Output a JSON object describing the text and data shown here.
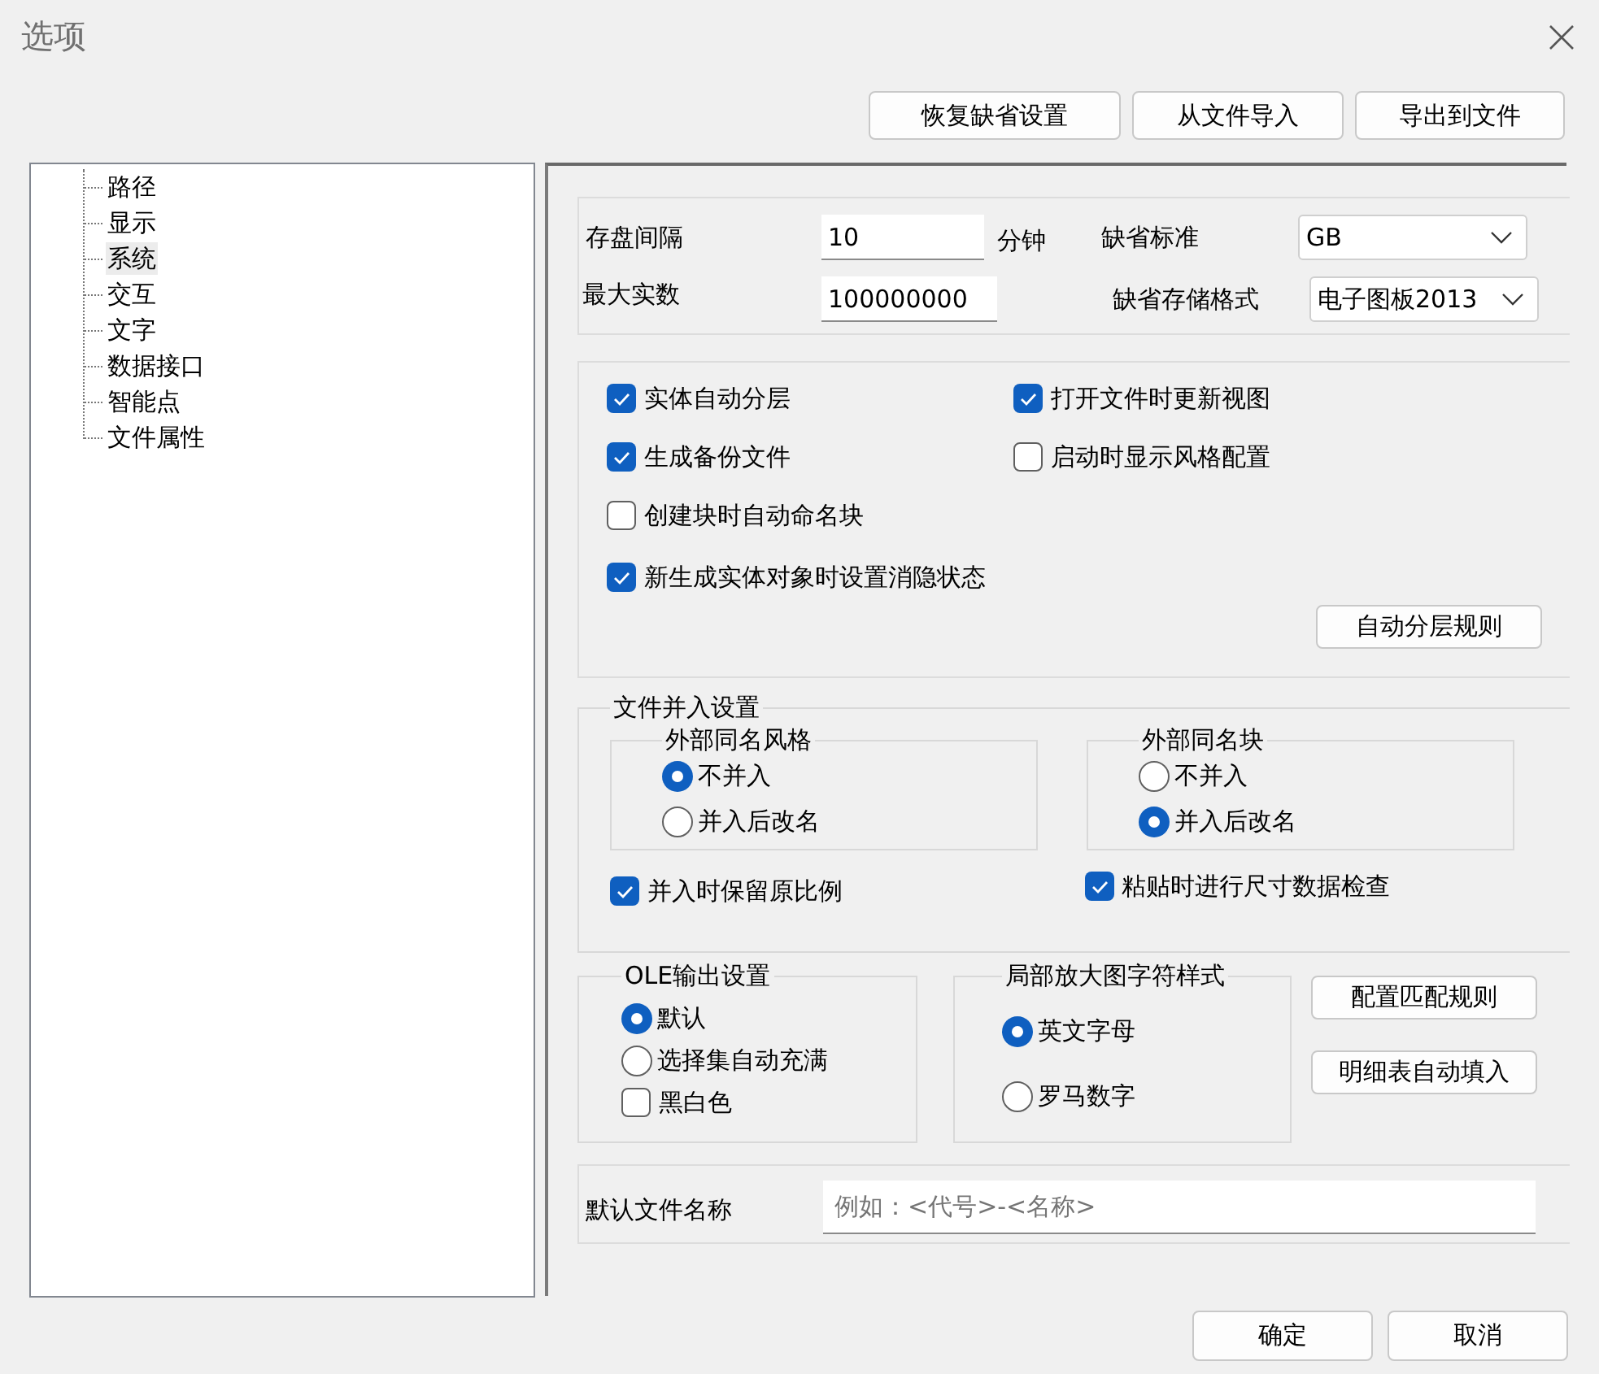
{
  "window": {
    "title": "选项"
  },
  "top_buttons": [
    "恢复缺省设置",
    "从文件导入",
    "导出到文件"
  ],
  "tree": {
    "items": [
      {
        "label": "路径",
        "selected": false
      },
      {
        "label": "显示",
        "selected": false
      },
      {
        "label": "系统",
        "selected": true
      },
      {
        "label": "交互",
        "selected": false
      },
      {
        "label": "文字",
        "selected": false
      },
      {
        "label": "数据接口",
        "selected": false
      },
      {
        "label": "智能点",
        "selected": false
      },
      {
        "label": "文件属性",
        "selected": false
      }
    ]
  },
  "save": {
    "interval_label": "存盘间隔",
    "interval": "10",
    "interval_unit": "分钟",
    "max_label": "最大实数",
    "max": "100000000",
    "standard_label": "缺省标准",
    "standard": "GB",
    "format_label": "缺省存储格式",
    "format": "电子图板2013"
  },
  "options": [
    {
      "label": "实体自动分层",
      "checked": true
    },
    {
      "label": "打开文件时更新视图",
      "checked": true
    },
    {
      "label": "生成备份文件",
      "checked": true
    },
    {
      "label": "启动时显示风格配置",
      "checked": false
    },
    {
      "label": "创建块时自动命名块",
      "checked": false
    },
    {
      "label": "新生成实体对象时设置消隐状态",
      "checked": true
    }
  ],
  "layer_rules_button": "自动分层规则",
  "merge": {
    "title": "文件并入设置",
    "groups": [
      {
        "title": "外部同名风格",
        "options": [
          {
            "label": "不并入",
            "selected": true
          },
          {
            "label": "并入后改名",
            "selected": false
          }
        ]
      },
      {
        "title": "外部同名块",
        "options": [
          {
            "label": "不并入",
            "selected": false
          },
          {
            "label": "并入后改名",
            "selected": true
          }
        ]
      }
    ],
    "checks": [
      {
        "label": "并入时保留原比例",
        "checked": true
      },
      {
        "label": "粘贴时进行尺寸数据检查",
        "checked": true
      }
    ]
  },
  "ole": {
    "title": "OLE输出设置",
    "options": [
      {
        "kind": "radio",
        "label": "默认",
        "selected": true
      },
      {
        "kind": "radio",
        "label": "选择集自动充满",
        "selected": false
      },
      {
        "kind": "checkbox",
        "label": "黑白色",
        "checked": false
      }
    ]
  },
  "zoom_style": {
    "title": "局部放大图字符样式",
    "options": [
      {
        "label": "英文字母",
        "selected": true
      },
      {
        "label": "罗马数字",
        "selected": false
      }
    ]
  },
  "side_buttons": [
    "配置匹配规则",
    "明细表自动填入"
  ],
  "filename": {
    "label": "默认文件名称",
    "placeholder": "例如：<代号>-<名称>"
  },
  "footer_buttons": [
    "确定",
    "取消"
  ]
}
